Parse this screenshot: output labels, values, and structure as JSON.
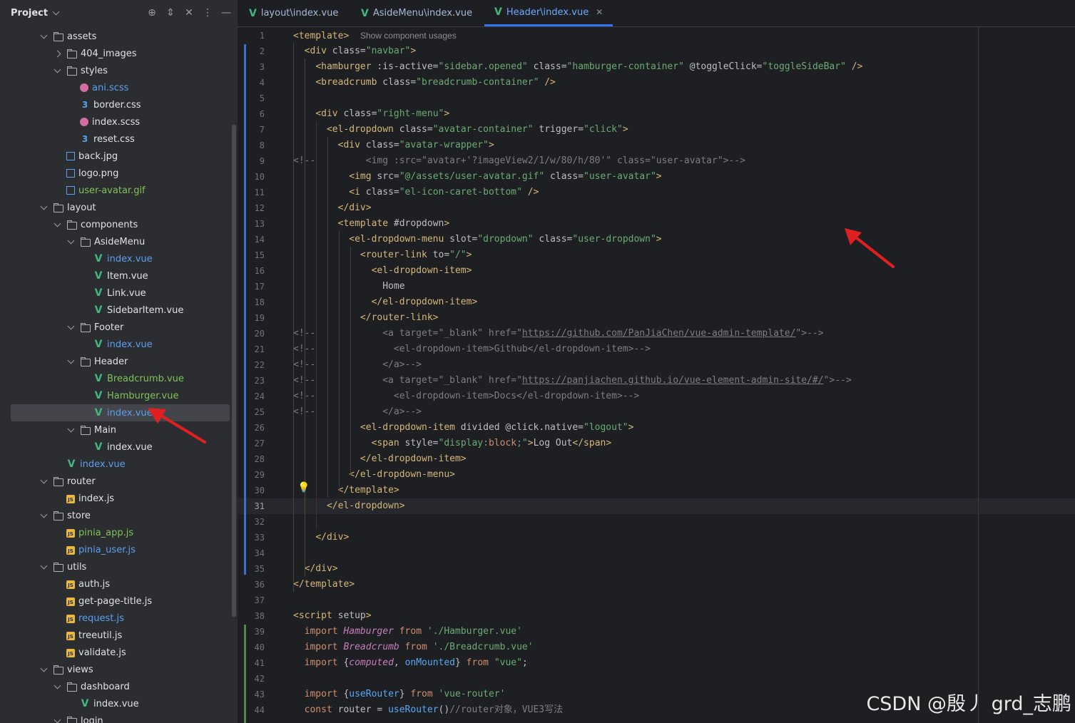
{
  "project": {
    "title": "Project",
    "tree": [
      {
        "label": "assets",
        "type": "folder",
        "depth": 0,
        "open": true
      },
      {
        "label": "404_images",
        "type": "folder",
        "depth": 1,
        "open": false
      },
      {
        "label": "styles",
        "type": "folder",
        "depth": 1,
        "open": true
      },
      {
        "label": "ani.scss",
        "type": "scss",
        "depth": 2,
        "color": "blue"
      },
      {
        "label": "border.css",
        "type": "css",
        "depth": 2
      },
      {
        "label": "index.scss",
        "type": "scss",
        "depth": 2
      },
      {
        "label": "reset.css",
        "type": "css",
        "depth": 2
      },
      {
        "label": "back.jpg",
        "type": "img",
        "depth": 1
      },
      {
        "label": "logo.png",
        "type": "img",
        "depth": 1
      },
      {
        "label": "user-avatar.gif",
        "type": "img",
        "depth": 1,
        "color": "green"
      },
      {
        "label": "layout",
        "type": "folder",
        "depth": 0,
        "open": true
      },
      {
        "label": "components",
        "type": "folder",
        "depth": 1,
        "open": true
      },
      {
        "label": "AsideMenu",
        "type": "folder",
        "depth": 2,
        "open": true
      },
      {
        "label": "index.vue",
        "type": "vue",
        "depth": 3,
        "color": "blue"
      },
      {
        "label": "Item.vue",
        "type": "vue",
        "depth": 3
      },
      {
        "label": "Link.vue",
        "type": "vue",
        "depth": 3
      },
      {
        "label": "SidebarItem.vue",
        "type": "vue",
        "depth": 3
      },
      {
        "label": "Footer",
        "type": "folder",
        "depth": 2,
        "open": true
      },
      {
        "label": "index.vue",
        "type": "vue",
        "depth": 3,
        "color": "blue"
      },
      {
        "label": "Header",
        "type": "folder",
        "depth": 2,
        "open": true
      },
      {
        "label": "Breadcrumb.vue",
        "type": "vue",
        "depth": 3,
        "color": "green"
      },
      {
        "label": "Hamburger.vue",
        "type": "vue",
        "depth": 3,
        "color": "green"
      },
      {
        "label": "index.vue",
        "type": "vue",
        "depth": 3,
        "color": "blue",
        "selected": true
      },
      {
        "label": "Main",
        "type": "folder",
        "depth": 2,
        "open": true
      },
      {
        "label": "index.vue",
        "type": "vue",
        "depth": 3
      },
      {
        "label": "index.vue",
        "type": "vue",
        "depth": 1,
        "color": "blue"
      },
      {
        "label": "router",
        "type": "folder",
        "depth": 0,
        "open": true
      },
      {
        "label": "index.js",
        "type": "js",
        "depth": 1
      },
      {
        "label": "store",
        "type": "folder",
        "depth": 0,
        "open": true
      },
      {
        "label": "pinia_app.js",
        "type": "js",
        "depth": 1,
        "color": "green"
      },
      {
        "label": "pinia_user.js",
        "type": "js",
        "depth": 1,
        "color": "blue"
      },
      {
        "label": "utils",
        "type": "folder",
        "depth": 0,
        "open": true
      },
      {
        "label": "auth.js",
        "type": "js",
        "depth": 1
      },
      {
        "label": "get-page-title.js",
        "type": "js",
        "depth": 1
      },
      {
        "label": "request.js",
        "type": "js",
        "depth": 1,
        "color": "blue"
      },
      {
        "label": "treeutil.js",
        "type": "js",
        "depth": 1
      },
      {
        "label": "validate.js",
        "type": "js",
        "depth": 1
      },
      {
        "label": "views",
        "type": "folder",
        "depth": 0,
        "open": true
      },
      {
        "label": "dashboard",
        "type": "folder",
        "depth": 1,
        "open": true
      },
      {
        "label": "index.vue",
        "type": "vue",
        "depth": 2
      },
      {
        "label": "login",
        "type": "folder",
        "depth": 1,
        "open": true
      }
    ]
  },
  "tabs": [
    {
      "label": "layout\\index.vue",
      "active": false,
      "closable": false
    },
    {
      "label": "AsideMenu\\index.vue",
      "active": false,
      "closable": false
    },
    {
      "label": "Header\\index.vue",
      "active": true,
      "closable": true
    }
  ],
  "editor": {
    "current_line": 31,
    "lines": [
      [
        [
          "t",
          "<template>"
        ],
        [
          "a",
          "  "
        ],
        [
          "hint",
          "Show component usages"
        ]
      ],
      [
        [
          "a",
          "  "
        ],
        [
          "t",
          "<div"
        ],
        [
          "a",
          " class="
        ],
        [
          "s",
          "\"navbar\""
        ],
        [
          "t",
          ">"
        ]
      ],
      [
        [
          "a",
          "    "
        ],
        [
          "t",
          "<hamburger"
        ],
        [
          "a",
          " :is-active="
        ],
        [
          "s",
          "\"sidebar.opened\""
        ],
        [
          "a",
          " class="
        ],
        [
          "s",
          "\"hamburger-container\""
        ],
        [
          "a",
          " @toggleClick="
        ],
        [
          "s",
          "\"toggleSideBar\""
        ],
        [
          "a",
          " "
        ],
        [
          "t",
          "/>"
        ]
      ],
      [
        [
          "a",
          "    "
        ],
        [
          "t",
          "<breadcrumb"
        ],
        [
          "a",
          " class="
        ],
        [
          "s",
          "\"breadcrumb-container\""
        ],
        [
          "a",
          " "
        ],
        [
          "t",
          "/>"
        ]
      ],
      [],
      [
        [
          "a",
          "    "
        ],
        [
          "t",
          "<div"
        ],
        [
          "a",
          " class="
        ],
        [
          "s",
          "\"right-menu\""
        ],
        [
          "t",
          ">"
        ]
      ],
      [
        [
          "a",
          "      "
        ],
        [
          "t",
          "<el-dropdown"
        ],
        [
          "a",
          " class="
        ],
        [
          "s",
          "\"avatar-container\""
        ],
        [
          "a",
          " trigger="
        ],
        [
          "s",
          "\"click\""
        ],
        [
          "t",
          ">"
        ]
      ],
      [
        [
          "a",
          "        "
        ],
        [
          "t",
          "<div"
        ],
        [
          "a",
          " class="
        ],
        [
          "s",
          "\"avatar-wrapper\""
        ],
        [
          "t",
          ">"
        ]
      ],
      [
        [
          "c",
          "<!--         <img :src=\"avatar+'?imageView2/1/w/80/h/80'\" class=\"user-avatar\">-->"
        ]
      ],
      [
        [
          "a",
          "          "
        ],
        [
          "t",
          "<img"
        ],
        [
          "a",
          " src="
        ],
        [
          "s",
          "\"@/assets/user-avatar.gif\""
        ],
        [
          "a",
          " class="
        ],
        [
          "s",
          "\"user-avatar\""
        ],
        [
          "t",
          ">"
        ]
      ],
      [
        [
          "a",
          "          "
        ],
        [
          "t",
          "<i"
        ],
        [
          "a",
          " class="
        ],
        [
          "s",
          "\"el-icon-caret-bottom\""
        ],
        [
          "a",
          " "
        ],
        [
          "t",
          "/>"
        ]
      ],
      [
        [
          "a",
          "        "
        ],
        [
          "t",
          "</div>"
        ]
      ],
      [
        [
          "a",
          "        "
        ],
        [
          "t",
          "<template"
        ],
        [
          "a",
          " #dropdown"
        ],
        [
          "t",
          ">"
        ]
      ],
      [
        [
          "a",
          "          "
        ],
        [
          "t",
          "<el-dropdown-menu"
        ],
        [
          "a",
          " slot="
        ],
        [
          "s",
          "\"dropdown\""
        ],
        [
          "a",
          " class="
        ],
        [
          "s",
          "\"user-dropdown\""
        ],
        [
          "t",
          ">"
        ]
      ],
      [
        [
          "a",
          "            "
        ],
        [
          "t",
          "<router-link"
        ],
        [
          "a",
          " to="
        ],
        [
          "s",
          "\"/\""
        ],
        [
          "t",
          ">"
        ]
      ],
      [
        [
          "a",
          "              "
        ],
        [
          "t",
          "<el-dropdown-item>"
        ]
      ],
      [
        [
          "a",
          "                Home"
        ]
      ],
      [
        [
          "a",
          "              "
        ],
        [
          "t",
          "</el-dropdown-item>"
        ]
      ],
      [
        [
          "a",
          "            "
        ],
        [
          "t",
          "</router-link>"
        ]
      ],
      [
        [
          "c",
          "<!--            <a target=\"_blank\" href=\""
        ],
        [
          "cu",
          "https://github.com/PanJiaChen/vue-admin-template/"
        ],
        [
          "c",
          "\">-->"
        ]
      ],
      [
        [
          "c",
          "<!--              <el-dropdown-item>Github</el-dropdown-item>-->"
        ]
      ],
      [
        [
          "c",
          "<!--            </a>-->"
        ]
      ],
      [
        [
          "c",
          "<!--            <a target=\"_blank\" href=\""
        ],
        [
          "cu",
          "https://panjiachen.github.io/vue-element-admin-site/#/"
        ],
        [
          "c",
          "\">-->"
        ]
      ],
      [
        [
          "c",
          "<!--              <el-dropdown-item>Docs</el-dropdown-item>-->"
        ]
      ],
      [
        [
          "c",
          "<!--            </a>-->"
        ]
      ],
      [
        [
          "a",
          "            "
        ],
        [
          "t",
          "<el-dropdown-item"
        ],
        [
          "a",
          " divided @click.native="
        ],
        [
          "s",
          "\"logout\""
        ],
        [
          "t",
          ">"
        ]
      ],
      [
        [
          "a",
          "              "
        ],
        [
          "t",
          "<span"
        ],
        [
          "a",
          " style="
        ],
        [
          "s",
          "\"display:"
        ],
        [
          "k",
          "block"
        ],
        [
          "s",
          ";\""
        ],
        [
          "t",
          ">"
        ],
        [
          "a",
          "Log Out"
        ],
        [
          "t",
          "</span>"
        ]
      ],
      [
        [
          "a",
          "            "
        ],
        [
          "t",
          "</el-dropdown-item>"
        ]
      ],
      [
        [
          "a",
          "          "
        ],
        [
          "t",
          "</el-dropdown-menu>"
        ]
      ],
      [
        [
          "a",
          "        "
        ],
        [
          "t",
          "</template>"
        ]
      ],
      [
        [
          "a",
          "      "
        ],
        [
          "t",
          "</el-dropdown>"
        ]
      ],
      [],
      [
        [
          "a",
          "    "
        ],
        [
          "t",
          "</div>"
        ]
      ],
      [],
      [
        [
          "a",
          "  "
        ],
        [
          "t",
          "</div>"
        ]
      ],
      [
        [
          "t",
          "</template>"
        ]
      ],
      [],
      [
        [
          "t",
          "<script"
        ],
        [
          "a",
          " setup"
        ],
        [
          "t",
          ">"
        ]
      ],
      [
        [
          "a",
          "  "
        ],
        [
          "k",
          "import "
        ],
        [
          "it",
          "Hamburger"
        ],
        [
          "k",
          " from "
        ],
        [
          "s",
          "'./Hamburger.vue'"
        ]
      ],
      [
        [
          "a",
          "  "
        ],
        [
          "k",
          "import "
        ],
        [
          "it",
          "Breadcrumb"
        ],
        [
          "k",
          " from "
        ],
        [
          "s",
          "'./Breadcrumb.vue'"
        ]
      ],
      [
        [
          "a",
          "  "
        ],
        [
          "k",
          "import "
        ],
        [
          "a",
          "{"
        ],
        [
          "it",
          "computed"
        ],
        [
          "a",
          ", "
        ],
        [
          "id",
          "onMounted"
        ],
        [
          "a",
          "}"
        ],
        [
          "k",
          " from "
        ],
        [
          "s",
          "\"vue\""
        ],
        [
          "a",
          ";"
        ]
      ],
      [],
      [
        [
          "a",
          "  "
        ],
        [
          "k",
          "import "
        ],
        [
          "a",
          "{"
        ],
        [
          "id",
          "useRouter"
        ],
        [
          "a",
          "}"
        ],
        [
          "k",
          " from "
        ],
        [
          "s",
          "'vue-router'"
        ]
      ],
      [
        [
          "a",
          "  "
        ],
        [
          "k",
          "const "
        ],
        [
          "a",
          "router = "
        ],
        [
          "id",
          "useRouter"
        ],
        [
          "a",
          "()"
        ],
        [
          "c",
          "//router对象，VUE3写法"
        ]
      ]
    ]
  },
  "watermark": "CSDN @殷丿 grd_志鹏",
  "colors": {
    "accent": "#3574f0",
    "arrow": "#e02020"
  }
}
